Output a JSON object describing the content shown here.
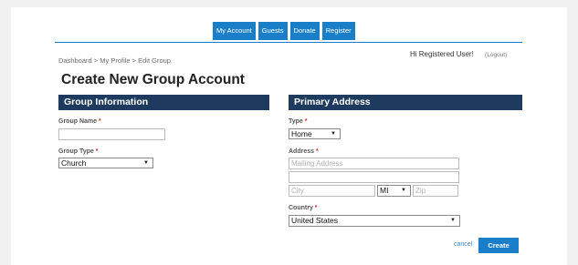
{
  "nav": {
    "items": [
      "My Account",
      "Guests",
      "Donate",
      "Register"
    ]
  },
  "breadcrumb": "Dashboard > My Profile > Edit Group",
  "user": {
    "greeting": "Hi  Registered User!",
    "logout": "(Logout)"
  },
  "title": "Create New Group Account",
  "group_info": {
    "heading": "Group Information",
    "group_name_label": "Group Name",
    "group_name_value": "",
    "group_type_label": "Group Type",
    "group_type_value": "Church"
  },
  "primary_address": {
    "heading": "Primary Address",
    "type_label": "Type",
    "type_value": "Home",
    "address_label": "Address",
    "mailing_placeholder": "Mailing Address",
    "address2_value": "",
    "city_placeholder": "City",
    "state_value": "MI",
    "zip_placeholder": "Zip",
    "country_label": "Country",
    "country_value": "United States"
  },
  "required_mark": "*",
  "actions": {
    "cancel": "cancel",
    "create": "Create"
  },
  "colors": {
    "nav_blue": "#1a7fc8",
    "section_navy": "#1e3a5f",
    "required_red": "#d12b2b"
  },
  "icons": [
    "chevron-down-icon"
  ]
}
